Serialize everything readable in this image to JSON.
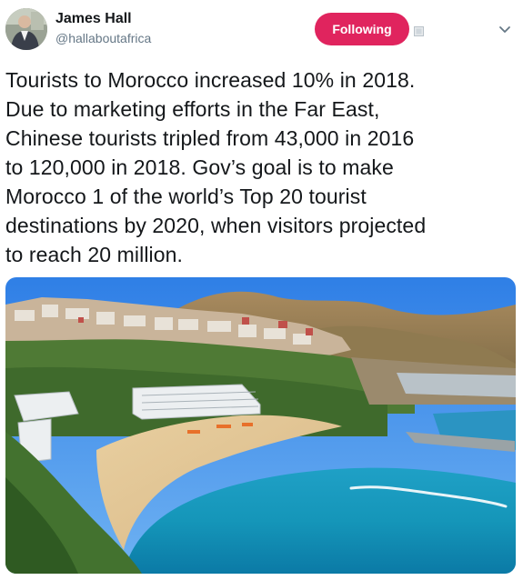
{
  "user": {
    "display_name": "James Hall",
    "handle": "@hallaboutafrica",
    "avatar_icon": "profile-photo"
  },
  "actions": {
    "follow_label": "Following",
    "follow_color": "#e0245e",
    "notify_icon": "notification-icon",
    "menu_icon": "chevron-down-icon"
  },
  "tweet": {
    "text": "Tourists to Morocco increased 10% in 2018.\nDue to marketing efforts in the Far East,\nChinese tourists tripled from 43,000 in 2016\nto 120,000 in 2018. Gov’s goal is to make\nMorocco 1 of the world’s Top 20 tourist\ndestinations by 2020, when visitors projected\nto reach 20 million."
  },
  "media": {
    "type": "photo"
  },
  "colors": {
    "text": "#14171a",
    "secondary": "#657786"
  }
}
